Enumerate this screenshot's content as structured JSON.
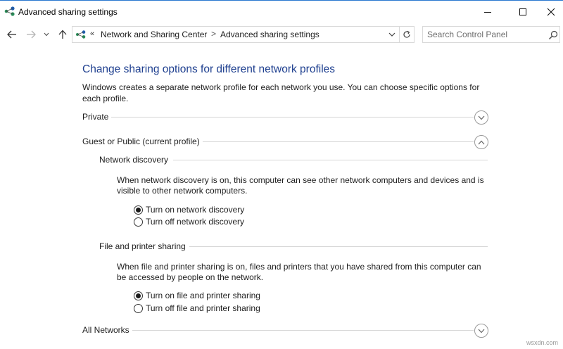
{
  "window": {
    "title": "Advanced sharing settings",
    "minimize_icon": "minimize-icon",
    "maximize_icon": "maximize-icon",
    "close_icon": "close-icon"
  },
  "navigation": {
    "back_icon": "back-arrow-icon",
    "forward_icon": "forward-arrow-icon",
    "recent_icon": "chevron-down-icon",
    "up_icon": "up-arrow-icon",
    "address": {
      "overflow": "«",
      "breadcrumbs": [
        "Network and Sharing Center",
        "Advanced sharing settings"
      ],
      "separator": ">"
    },
    "refresh_icon": "refresh-icon",
    "search": {
      "placeholder": "Search Control Panel",
      "value": ""
    }
  },
  "main": {
    "title": "Change sharing options for different network profiles",
    "description": "Windows creates a separate network profile for each network you use. You can choose specific options for each profile.",
    "profiles": [
      {
        "label": "Private",
        "expanded": false
      },
      {
        "label": "Guest or Public (current profile)",
        "expanded": true
      },
      {
        "label": "All Networks",
        "expanded": false
      }
    ],
    "network_discovery": {
      "heading": "Network discovery",
      "text": "When network discovery is on, this computer can see other network computers and devices and is visible to other network computers.",
      "options": [
        {
          "label": "Turn on network discovery",
          "checked": true
        },
        {
          "label": "Turn off network discovery",
          "checked": false
        }
      ]
    },
    "file_printer_sharing": {
      "heading": "File and printer sharing",
      "text": "When file and printer sharing is on, files and printers that you have shared from this computer can be accessed by people on the network.",
      "options": [
        {
          "label": "Turn on file and printer sharing",
          "checked": true
        },
        {
          "label": "Turn off file and printer sharing",
          "checked": false
        }
      ]
    }
  },
  "watermark": "wsxdn.com"
}
